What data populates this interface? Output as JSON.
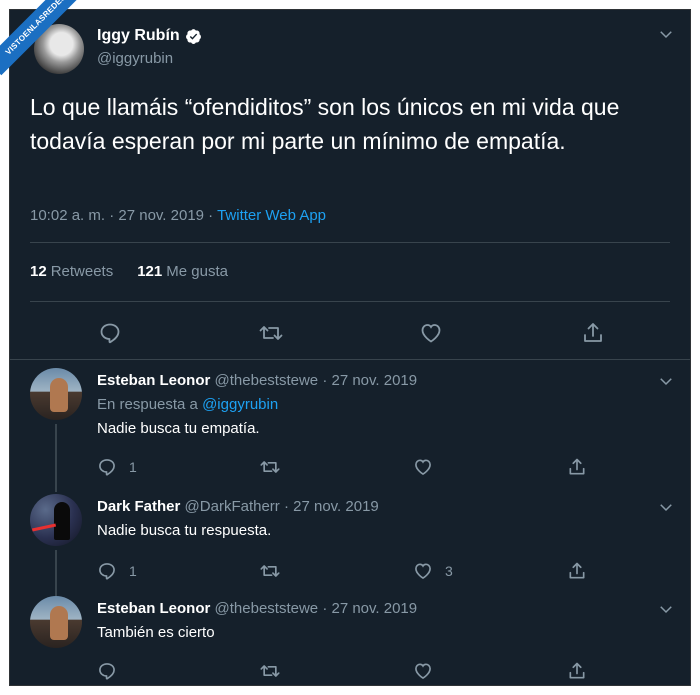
{
  "watermark": "VISTOENLASREDES",
  "tweet": {
    "author_name": "Iggy Rubín",
    "author_handle": "@iggyrubin",
    "text": "Lo que llamáis “ofendiditos” son los únicos en mi vida que todavía esperan por mi parte un mínimo de empatía.",
    "time": "10:02 a. m. · 27 nov. 2019 · ",
    "app": "Twitter Web App",
    "retweets_count": "12",
    "retweets_label": "Retweets",
    "likes_count": "121",
    "likes_label": "Me gusta"
  },
  "replies": [
    {
      "name": "Esteban Leonor",
      "handle_date": "@thebeststewe · 27 nov. 2019",
      "reply_to_prefix": "En respuesta a ",
      "reply_to_handle": "@iggyrubin",
      "text": "Nadie busca tu empatía.",
      "reply_count": "1",
      "like_count": ""
    },
    {
      "name": "Dark Father",
      "handle_date": "@DarkFatherr · 27 nov. 2019",
      "text": "Nadie busca tu respuesta.",
      "reply_count": "1",
      "like_count": "3"
    },
    {
      "name": "Esteban Leonor",
      "handle_date": "@thebeststewe · 27 nov. 2019",
      "text": "También es cierto",
      "reply_count": "",
      "like_count": ""
    }
  ],
  "colors": {
    "background": "#15202b",
    "accent": "#1da1f2",
    "muted": "#8899a6",
    "divider": "#38444d"
  },
  "icons": {
    "verified": "verified-badge-icon",
    "more": "chevron-down-icon",
    "reply": "reply-icon",
    "retweet": "retweet-icon",
    "like": "heart-icon",
    "share": "share-icon"
  }
}
